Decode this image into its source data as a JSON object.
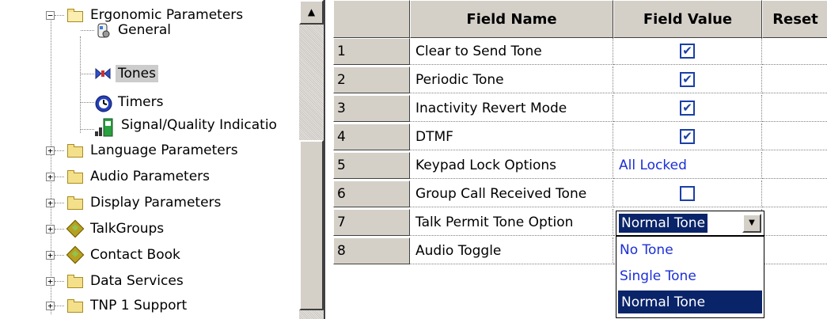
{
  "tree": {
    "nodes": [
      {
        "label": "Ergonomic Parameters",
        "icon": "folder-open-icon",
        "expander": "−"
      },
      {
        "label": "General",
        "icon": "phone-settings-icon"
      },
      {
        "label": "Tones",
        "icon": "tones-icon"
      },
      {
        "label": "Timers",
        "icon": "timer-icon"
      },
      {
        "label": "Signal/Quality Indicatio",
        "icon": "signal-quality-icon"
      },
      {
        "label": "Language Parameters",
        "icon": "folder-icon",
        "expander": "+"
      },
      {
        "label": "Audio Parameters",
        "icon": "folder-icon",
        "expander": "+"
      },
      {
        "label": "Display Parameters",
        "icon": "folder-icon",
        "expander": "+"
      },
      {
        "label": "TalkGroups",
        "icon": "talkgroup-icon",
        "expander": "+"
      },
      {
        "label": "Contact Book",
        "icon": "contact-book-icon",
        "expander": "+"
      },
      {
        "label": "Data Services",
        "icon": "folder-icon",
        "expander": "+"
      },
      {
        "label": "TNP 1 Support",
        "icon": "folder-icon",
        "expander": "+"
      }
    ],
    "scroll_up_icon": "▲"
  },
  "grid": {
    "headers": {
      "field_name": "Field Name",
      "field_value": "Field Value",
      "reset": "Reset"
    },
    "rows": [
      {
        "num": "1",
        "name": "Clear to Send Tone",
        "value_type": "checkbox",
        "checked": true
      },
      {
        "num": "2",
        "name": "Periodic Tone",
        "value_type": "checkbox",
        "checked": true
      },
      {
        "num": "3",
        "name": "Inactivity Revert Mode",
        "value_type": "checkbox",
        "checked": true
      },
      {
        "num": "4",
        "name": "DTMF",
        "value_type": "checkbox",
        "checked": true
      },
      {
        "num": "5",
        "name": "Keypad Lock Options",
        "value_type": "text",
        "value": "All Locked"
      },
      {
        "num": "6",
        "name": "Group Call Received Tone",
        "value_type": "checkbox",
        "checked": false
      },
      {
        "num": "7",
        "name": "Talk Permit Tone Option",
        "value_type": "dropdown"
      },
      {
        "num": "8",
        "name": "Audio Toggle",
        "value_type": "none"
      }
    ],
    "dropdown": {
      "current": "Normal Tone",
      "arrow": "▼",
      "options": [
        "No Tone",
        "Single Tone",
        "Normal Tone"
      ],
      "selected_index": 2
    },
    "check_glyph": "✔"
  },
  "colors": {
    "selection": "#0a246a",
    "link": "#1c2fd6",
    "checkbox": "#1a3fa6",
    "chrome": "#d4d0c8"
  }
}
